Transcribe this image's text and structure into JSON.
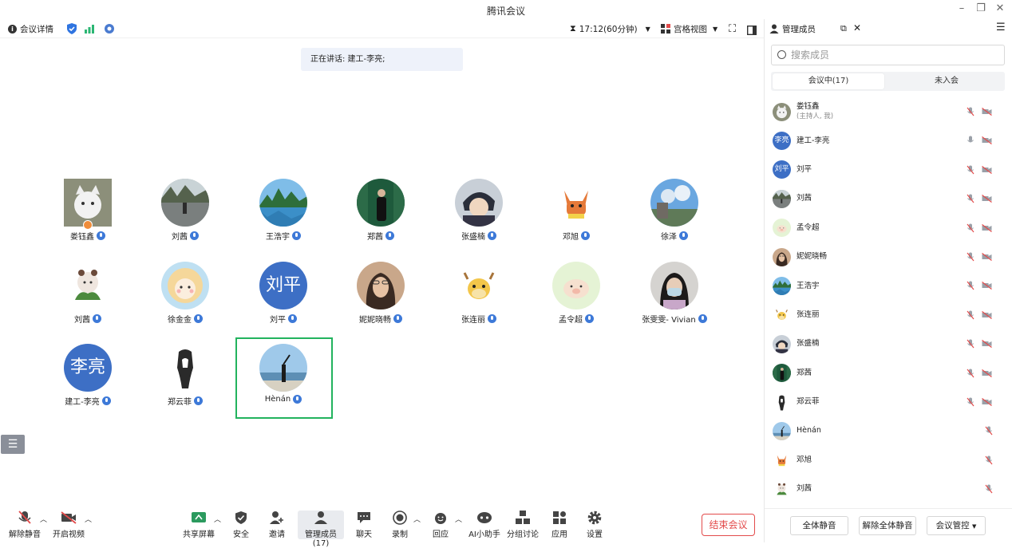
{
  "window": {
    "title": "腾讯会议"
  },
  "toolbar": {
    "details_label": "会议详情",
    "timer": "17:12(60分钟)",
    "view_label": "宫格视图"
  },
  "speaking": {
    "text": "正在讲话: 建工-李亮;"
  },
  "tiles": [
    {
      "name": "娄钰鑫",
      "avatar": "photo-cat",
      "host": true
    },
    {
      "name": "刘茜",
      "avatar": "photo-street"
    },
    {
      "name": "王浩宇",
      "avatar": "photo-mountain"
    },
    {
      "name": "郑茜",
      "avatar": "photo-person-dark"
    },
    {
      "name": "张盛楠",
      "avatar": "photo-anime"
    },
    {
      "name": "邓旭",
      "avatar": "cartoon-fox"
    },
    {
      "name": "徐泽",
      "avatar": "photo-sky"
    },
    {
      "name": "刘茜",
      "avatar": "cartoon-girl"
    },
    {
      "name": "徐金金",
      "avatar": "cartoon-baby"
    },
    {
      "name": "刘平",
      "avatar_text": "刘平"
    },
    {
      "name": "妮妮晓畅",
      "avatar": "photo-woman"
    },
    {
      "name": "张连丽",
      "avatar": "cartoon-cow"
    },
    {
      "name": "孟令超",
      "avatar": "cartoon-pig"
    },
    {
      "name": "张雯雯- Vivian",
      "avatar": "photo-mask"
    },
    {
      "name": "建工-李亮",
      "avatar_text": "李亮",
      "speaking": true
    },
    {
      "name": "郑云菲",
      "avatar": "sketch-girl"
    },
    {
      "name": "Hènán",
      "avatar": "photo-beach"
    }
  ],
  "bottombar": {
    "unmute": "解除静音",
    "video": "开启视频",
    "share": "共享屏幕",
    "security": "安全",
    "invite": "邀请",
    "members": "管理成员(17)",
    "chat": "聊天",
    "record": "录制",
    "reaction": "回应",
    "ai": "AI小助手",
    "breakout": "分组讨论",
    "apps": "应用",
    "settings": "设置",
    "end": "结束会议"
  },
  "panel": {
    "title": "管理成员",
    "search_placeholder": "搜索成员",
    "tab_in": "会议中(17)",
    "tab_out": "未入会",
    "members": [
      {
        "name": "娄钰鑫",
        "sub": "(主持人, 我)",
        "avatar": "photo-cat",
        "cam": true
      },
      {
        "name": "建工-李亮",
        "avatar_text": "李亮",
        "cam": true,
        "mic_on": true
      },
      {
        "name": "刘平",
        "avatar_text": "刘平",
        "cam": true
      },
      {
        "name": "刘茜",
        "avatar": "photo-street",
        "cam": true
      },
      {
        "name": "孟令超",
        "avatar": "cartoon-pig",
        "cam": true
      },
      {
        "name": "妮妮晓畅",
        "avatar": "photo-woman",
        "cam": true
      },
      {
        "name": "王浩宇",
        "avatar": "photo-mountain",
        "cam": true
      },
      {
        "name": "张连丽",
        "avatar": "cartoon-cow",
        "cam": true
      },
      {
        "name": "张盛楠",
        "avatar": "photo-anime",
        "cam": true
      },
      {
        "name": "郑茜",
        "avatar": "photo-person-dark",
        "cam": true
      },
      {
        "name": "郑云菲",
        "avatar": "sketch-girl",
        "cam": true
      },
      {
        "name": "Hènán",
        "avatar": "photo-beach",
        "cam": false
      },
      {
        "name": "邓旭",
        "avatar": "cartoon-fox",
        "cam": false
      },
      {
        "name": "刘茜",
        "avatar": "cartoon-girl",
        "cam": false
      }
    ],
    "mute_all": "全体静音",
    "unmute_all": "解除全体静音",
    "control": "会议管控"
  },
  "colors": {
    "accent": "#3d6fc5",
    "speaking_border": "#22b35e",
    "end": "#e34b4b",
    "host_badge": "#f08d3a"
  }
}
